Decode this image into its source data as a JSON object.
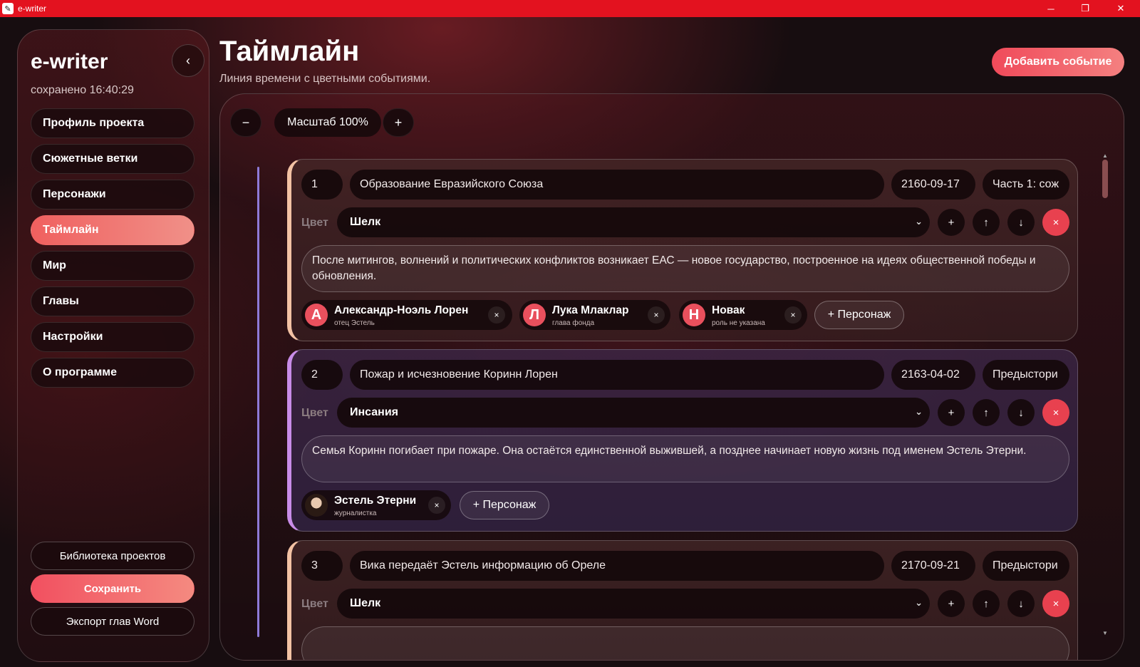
{
  "window": {
    "title": "e-writer",
    "icon": "app-logo-icon"
  },
  "sidebar": {
    "brand": "e-writer",
    "saved": "сохранено 16:40:29",
    "collapse": "‹",
    "items": [
      {
        "label": "Профиль проекта"
      },
      {
        "label": "Сюжетные ветки"
      },
      {
        "label": "Персонажи"
      },
      {
        "label": "Таймлайн",
        "active": true
      },
      {
        "label": "Мир"
      },
      {
        "label": "Главы"
      },
      {
        "label": "Настройки"
      },
      {
        "label": "О программе"
      }
    ],
    "library": "Библиотека проектов",
    "save": "Сохранить",
    "export": "Экспорт глав Word"
  },
  "header": {
    "title": "Таймлайн",
    "subtitle": "Линия времени с цветными событиями.",
    "add_event": "Добавить событие"
  },
  "zoom": {
    "minus": "−",
    "label": "Масштаб 100%",
    "plus": "+"
  },
  "color_label": "Цвет",
  "add_character": "+ Персонаж",
  "events": [
    {
      "index": "1",
      "title": "Образование Евразийского Союза",
      "date": "2160-09-17",
      "part": "Часть 1: сож",
      "color": "Шелк",
      "accent": "#f3c2a4",
      "description": "После митингов, волнений и политических конфликтов возникает ЕАС — новое государство, построенное на идеях общественной победы и обновления.",
      "characters": [
        {
          "initial": "А",
          "name": "Александр-Ноэль Лорен",
          "role": "отец Эстель"
        },
        {
          "initial": "Л",
          "name": "Лука Млаклар",
          "role": "глава фонда"
        },
        {
          "initial": "Н",
          "name": "Новак",
          "role": "роль не указана"
        }
      ]
    },
    {
      "index": "2",
      "title": "Пожар и исчезновение Коринн Лорен",
      "date": "2163-04-02",
      "part": "Предыстори",
      "color": "Инсания",
      "accent": "#c88ce8",
      "description": "Семья Коринн погибает при пожаре. Она остаётся единственной выжившей, а позднее начинает новую жизнь под именем Эстель Этерни.",
      "characters": [
        {
          "initial": "",
          "name": "Эстель Этерни",
          "role": "журналистка"
        }
      ]
    },
    {
      "index": "3",
      "title": "Вика передаёт Эстель информацию об Ореле",
      "date": "2170-09-21",
      "part": "Предыстори",
      "color": "Шелк",
      "accent": "#f3c2a4"
    }
  ],
  "controls": {
    "add": "+",
    "up": "↑",
    "down": "↓",
    "delete": "×",
    "remove_char": "×"
  }
}
